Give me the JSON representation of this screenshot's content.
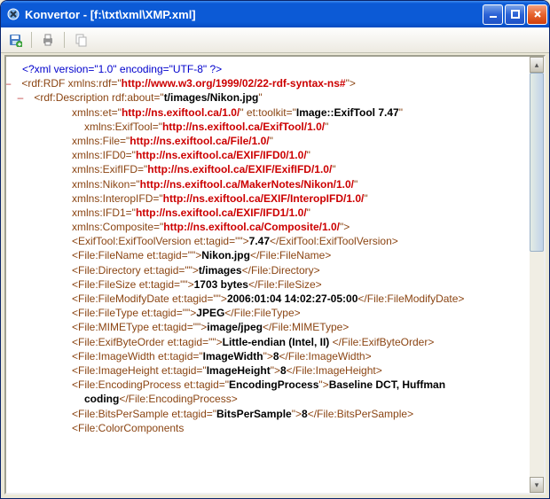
{
  "window": {
    "app": "Konvertor",
    "path": "[f:\\txt\\xml\\XMP.xml]"
  },
  "xml": {
    "decl": "<?xml version=\"1.0\" encoding=\"UTF-8\" ?>",
    "rdf_open_a": "<rdf:RDF xmlns:rdf=\"",
    "rdf_open_url": "http://www.w3.org/1999/02/22-rdf-syntax-ns#",
    "rdf_open_c": "\">",
    "desc_open_a": "<rdf:Description rdf:about=\"",
    "desc_about": "t/images/Nikon.jpg",
    "desc_open_c": "\"",
    "et_attr_a": "xmlns:et=\"",
    "et_url": "http://ns.exiftool.ca/1.0/",
    "et_attr_b": "\" et:toolkit=\"",
    "et_toolkit": "Image::ExifTool 7.47",
    "et_attr_c": "\" xmlns:ExifTool=\"",
    "ns_exiftool": "http://ns.exiftool.ca/ExifTool/1.0/",
    "file_ns_a": "xmlns:File=\"",
    "ns_file": "http://ns.exiftool.ca/File/1.0/",
    "ifd0_a": "xmlns:IFD0=\"",
    "ns_ifd0": "http://ns.exiftool.ca/EXIF/IFD0/1.0/",
    "exififd_a": "xmlns:ExifIFD=\"",
    "ns_exififd": "http://ns.exiftool.ca/EXIF/ExifIFD/1.0/",
    "nikon_a": "xmlns:Nikon=\"",
    "ns_nikon": "http://ns.exiftool.ca/MakerNotes/Nikon/1.0/",
    "interop_a": "xmlns:InteropIFD=\"",
    "ns_interop": "http://ns.exiftool.ca/EXIF/InteropIFD/1.0/",
    "ifd1_a": "xmlns:IFD1=\"",
    "ns_ifd1": "http://ns.exiftool.ca/EXIF/IFD1/1.0/",
    "comp_a": "xmlns:Composite=\"",
    "ns_comp": "http://ns.exiftool.ca/Composite/1.0/",
    "close_gt": "\">",
    "quot": "\"",
    "ver_a": "<ExifTool:ExifToolVersion et:tagid=\"\">",
    "ver_v": "7.47",
    "ver_c": "</ExifTool:ExifToolVersion>",
    "fn_a": "<File:FileName et:tagid=\"\">",
    "fn_v": "Nikon.jpg",
    "fn_c": "</File:FileName>",
    "dir_a": "<File:Directory et:tagid=\"\">",
    "dir_v": "t/images",
    "dir_c": "</File:Directory>",
    "sz_a": "<File:FileSize et:tagid=\"\">",
    "sz_v": "1703 bytes",
    "sz_c": "</File:FileSize>",
    "md_a": "<File:FileModifyDate et:tagid=\"\">",
    "md_v": "2006:01:04 14:02:27-05:00",
    "md_c": "</File:FileModifyDate>",
    "ft_a": "<File:FileType et:tagid=\"\">",
    "ft_v": "JPEG",
    "ft_c": "</File:FileType>",
    "mt_a": "<File:MIMEType et:tagid=\"\">",
    "mt_v": "image/jpeg",
    "mt_c": "</File:MIMEType>",
    "bo_a": "<File:ExifByteOrder et:tagid=\"\">",
    "bo_v": "Little-endian (Intel, II)",
    "bo_c": "</File:ExifByteOrder>",
    "iw_a": "<File:ImageWidth et:tagid=\"",
    "iw_t": "ImageWidth",
    "iw_b": "\">",
    "iw_v": "8",
    "iw_c": "</File:ImageWidth>",
    "ih_a": "<File:ImageHeight et:tagid=\"",
    "ih_t": "ImageHeight",
    "ih_b": "\">",
    "ih_v": "8",
    "ih_c": "</File:ImageHeight>",
    "ep_a": "<File:EncodingProcess et:tagid=\"",
    "ep_t": "EncodingProcess",
    "ep_b": "\">",
    "ep_v": "Baseline DCT, Huffman coding",
    "ep_c": "</File:EncodingProcess>",
    "bps_a": "<File:BitsPerSample et:tagid=\"",
    "bps_t": "BitsPerSample",
    "bps_b": "\">",
    "bps_v": "8",
    "bps_c": "</File:BitsPerSample>",
    "cc_a": "<File:ColorComponents"
  }
}
